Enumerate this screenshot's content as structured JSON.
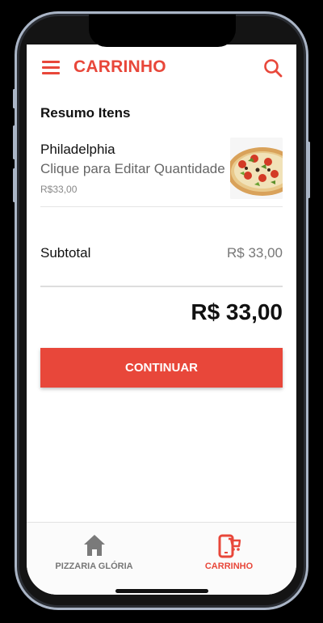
{
  "header": {
    "title": "CARRINHO",
    "accent_color": "#e8473a",
    "menu_icon": "hamburger-menu-icon",
    "search_icon": "search-icon"
  },
  "cart": {
    "section_title": "Resumo Itens",
    "items": [
      {
        "name": "Philadelphia",
        "hint": "Clique para Editar Quantidade",
        "price": "R$33,00",
        "image": "pizza-image"
      }
    ],
    "subtotal_label": "Subtotal",
    "subtotal_value": "R$ 33,00",
    "total_value": "R$ 33,00",
    "continue_label": "CONTINUAR"
  },
  "bottom_nav": {
    "items": [
      {
        "label": "PIZZARIA GLÓRIA",
        "icon": "home-icon",
        "active": false,
        "color": "#777777"
      },
      {
        "label": "CARRINHO",
        "icon": "cart-phone-icon",
        "active": true,
        "color": "#e8473a"
      }
    ]
  }
}
